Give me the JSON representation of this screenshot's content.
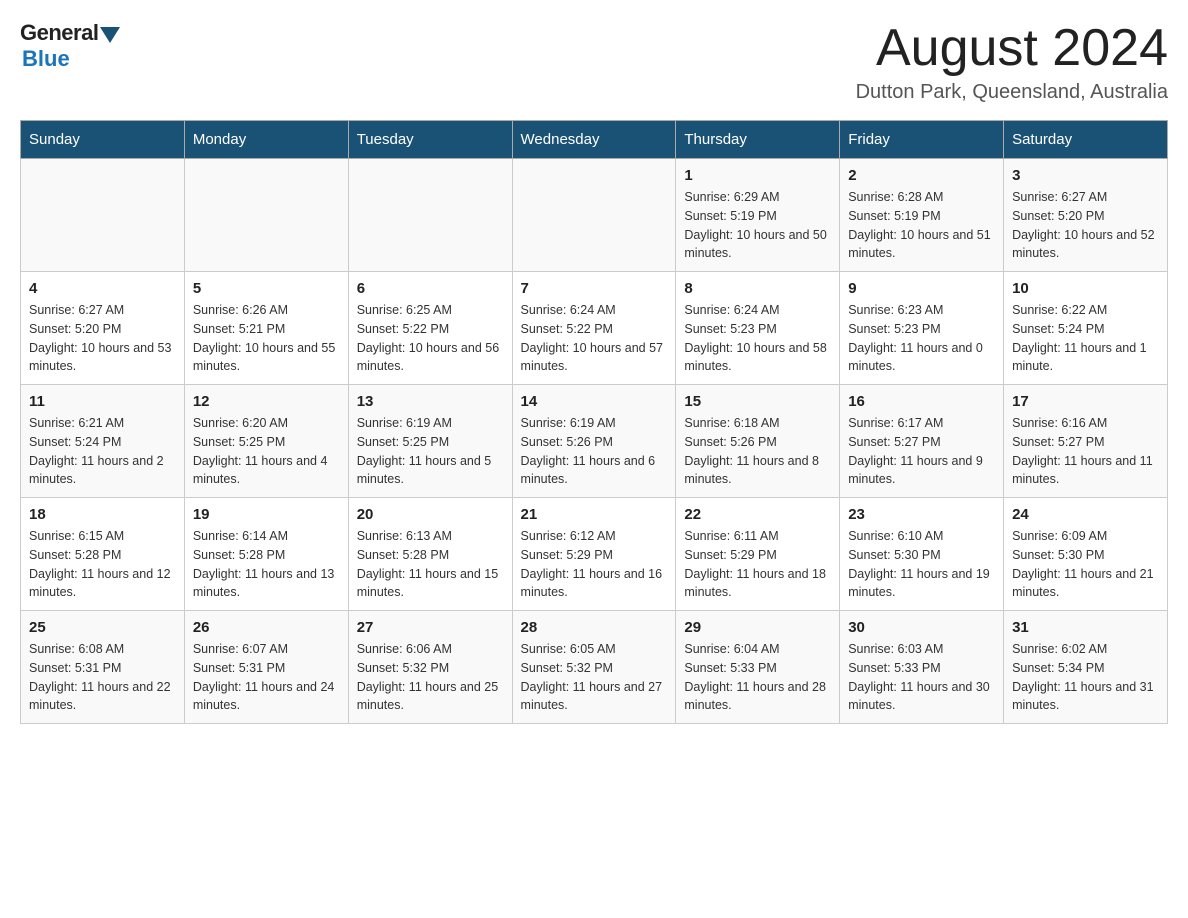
{
  "header": {
    "logo_general": "General",
    "logo_blue": "Blue",
    "month_title": "August 2024",
    "location": "Dutton Park, Queensland, Australia"
  },
  "weekdays": [
    "Sunday",
    "Monday",
    "Tuesday",
    "Wednesday",
    "Thursday",
    "Friday",
    "Saturday"
  ],
  "weeks": [
    [
      {
        "day": "",
        "info": ""
      },
      {
        "day": "",
        "info": ""
      },
      {
        "day": "",
        "info": ""
      },
      {
        "day": "",
        "info": ""
      },
      {
        "day": "1",
        "info": "Sunrise: 6:29 AM\nSunset: 5:19 PM\nDaylight: 10 hours and 50 minutes."
      },
      {
        "day": "2",
        "info": "Sunrise: 6:28 AM\nSunset: 5:19 PM\nDaylight: 10 hours and 51 minutes."
      },
      {
        "day": "3",
        "info": "Sunrise: 6:27 AM\nSunset: 5:20 PM\nDaylight: 10 hours and 52 minutes."
      }
    ],
    [
      {
        "day": "4",
        "info": "Sunrise: 6:27 AM\nSunset: 5:20 PM\nDaylight: 10 hours and 53 minutes."
      },
      {
        "day": "5",
        "info": "Sunrise: 6:26 AM\nSunset: 5:21 PM\nDaylight: 10 hours and 55 minutes."
      },
      {
        "day": "6",
        "info": "Sunrise: 6:25 AM\nSunset: 5:22 PM\nDaylight: 10 hours and 56 minutes."
      },
      {
        "day": "7",
        "info": "Sunrise: 6:24 AM\nSunset: 5:22 PM\nDaylight: 10 hours and 57 minutes."
      },
      {
        "day": "8",
        "info": "Sunrise: 6:24 AM\nSunset: 5:23 PM\nDaylight: 10 hours and 58 minutes."
      },
      {
        "day": "9",
        "info": "Sunrise: 6:23 AM\nSunset: 5:23 PM\nDaylight: 11 hours and 0 minutes."
      },
      {
        "day": "10",
        "info": "Sunrise: 6:22 AM\nSunset: 5:24 PM\nDaylight: 11 hours and 1 minute."
      }
    ],
    [
      {
        "day": "11",
        "info": "Sunrise: 6:21 AM\nSunset: 5:24 PM\nDaylight: 11 hours and 2 minutes."
      },
      {
        "day": "12",
        "info": "Sunrise: 6:20 AM\nSunset: 5:25 PM\nDaylight: 11 hours and 4 minutes."
      },
      {
        "day": "13",
        "info": "Sunrise: 6:19 AM\nSunset: 5:25 PM\nDaylight: 11 hours and 5 minutes."
      },
      {
        "day": "14",
        "info": "Sunrise: 6:19 AM\nSunset: 5:26 PM\nDaylight: 11 hours and 6 minutes."
      },
      {
        "day": "15",
        "info": "Sunrise: 6:18 AM\nSunset: 5:26 PM\nDaylight: 11 hours and 8 minutes."
      },
      {
        "day": "16",
        "info": "Sunrise: 6:17 AM\nSunset: 5:27 PM\nDaylight: 11 hours and 9 minutes."
      },
      {
        "day": "17",
        "info": "Sunrise: 6:16 AM\nSunset: 5:27 PM\nDaylight: 11 hours and 11 minutes."
      }
    ],
    [
      {
        "day": "18",
        "info": "Sunrise: 6:15 AM\nSunset: 5:28 PM\nDaylight: 11 hours and 12 minutes."
      },
      {
        "day": "19",
        "info": "Sunrise: 6:14 AM\nSunset: 5:28 PM\nDaylight: 11 hours and 13 minutes."
      },
      {
        "day": "20",
        "info": "Sunrise: 6:13 AM\nSunset: 5:28 PM\nDaylight: 11 hours and 15 minutes."
      },
      {
        "day": "21",
        "info": "Sunrise: 6:12 AM\nSunset: 5:29 PM\nDaylight: 11 hours and 16 minutes."
      },
      {
        "day": "22",
        "info": "Sunrise: 6:11 AM\nSunset: 5:29 PM\nDaylight: 11 hours and 18 minutes."
      },
      {
        "day": "23",
        "info": "Sunrise: 6:10 AM\nSunset: 5:30 PM\nDaylight: 11 hours and 19 minutes."
      },
      {
        "day": "24",
        "info": "Sunrise: 6:09 AM\nSunset: 5:30 PM\nDaylight: 11 hours and 21 minutes."
      }
    ],
    [
      {
        "day": "25",
        "info": "Sunrise: 6:08 AM\nSunset: 5:31 PM\nDaylight: 11 hours and 22 minutes."
      },
      {
        "day": "26",
        "info": "Sunrise: 6:07 AM\nSunset: 5:31 PM\nDaylight: 11 hours and 24 minutes."
      },
      {
        "day": "27",
        "info": "Sunrise: 6:06 AM\nSunset: 5:32 PM\nDaylight: 11 hours and 25 minutes."
      },
      {
        "day": "28",
        "info": "Sunrise: 6:05 AM\nSunset: 5:32 PM\nDaylight: 11 hours and 27 minutes."
      },
      {
        "day": "29",
        "info": "Sunrise: 6:04 AM\nSunset: 5:33 PM\nDaylight: 11 hours and 28 minutes."
      },
      {
        "day": "30",
        "info": "Sunrise: 6:03 AM\nSunset: 5:33 PM\nDaylight: 11 hours and 30 minutes."
      },
      {
        "day": "31",
        "info": "Sunrise: 6:02 AM\nSunset: 5:34 PM\nDaylight: 11 hours and 31 minutes."
      }
    ]
  ]
}
